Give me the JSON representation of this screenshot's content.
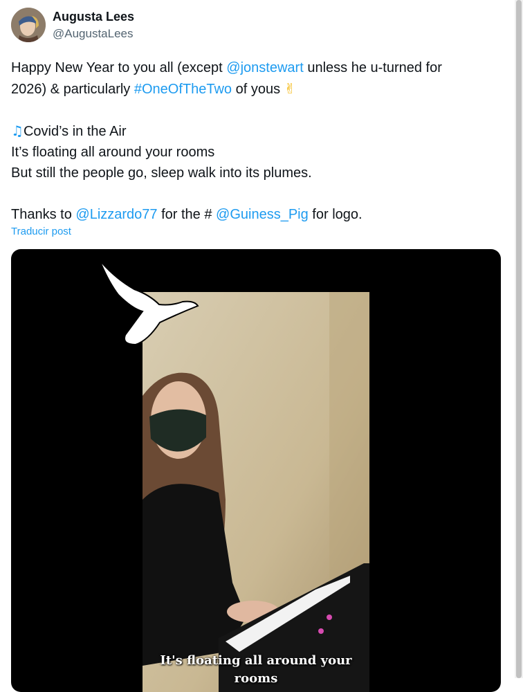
{
  "user": {
    "display_name": "Augusta Lees",
    "handle": "@AugustaLees"
  },
  "tweet": {
    "line1_pre": "Happy New Year to you all (except ",
    "mention_jon": "@jonstewart",
    "line1_post": " unless he u-turned for",
    "line2_pre": "2026) & particularly ",
    "hashtag": "#OneOfTheTwo",
    "line2_post": " of yous ",
    "peace_emoji": "✌",
    "music_emoji": "♫",
    "song_title": "Covid’s in the Air",
    "lyric1": "It’s floating all around your rooms",
    "lyric2": "But still the people go, sleep walk into its plumes.",
    "thanks_pre": "Thanks to ",
    "mention_lizzardo": "@Lizzardo77",
    "thanks_mid": " for the # ",
    "mention_guiness": "@Guiness_Pig",
    "thanks_post": " for logo."
  },
  "translate_label": "Traducir post",
  "video": {
    "subtitle": "It's floating all around your rooms"
  },
  "colors": {
    "link": "#1d9bf0",
    "text": "#0f1419",
    "secondary": "#536471"
  }
}
